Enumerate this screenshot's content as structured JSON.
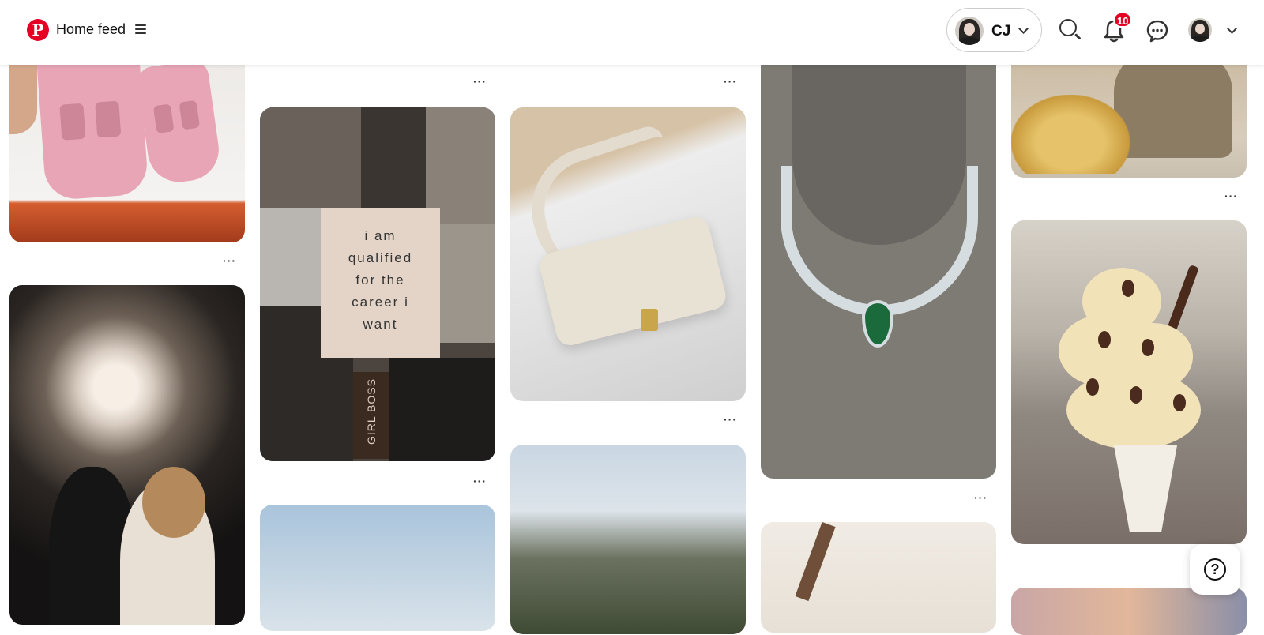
{
  "header": {
    "logo_glyph": "P",
    "feed_title": "Home feed",
    "profile_initials": "CJ",
    "notification_count": "10"
  },
  "icons": {
    "logo": "pinterest-logo",
    "menu": "hamburger-menu-icon",
    "search": "search-icon",
    "notifications": "bell-icon",
    "messages": "chat-bubble-icon",
    "help": "help-icon"
  },
  "pins": [
    {
      "id": "sandals",
      "more_label": "···"
    },
    {
      "id": "collage",
      "more_label": "···"
    },
    {
      "id": "bag",
      "more_label": "···"
    },
    {
      "id": "necklace",
      "more_label": "···"
    },
    {
      "id": "straw",
      "more_label": "···"
    }
  ],
  "collage": {
    "quote_lines": [
      "i am",
      "qualified",
      "for the",
      "career i",
      "want"
    ],
    "sign_text": "GIRL BOSS"
  },
  "help": {
    "glyph": "?"
  },
  "colors": {
    "brand": "#e60023",
    "text": "#111111"
  }
}
